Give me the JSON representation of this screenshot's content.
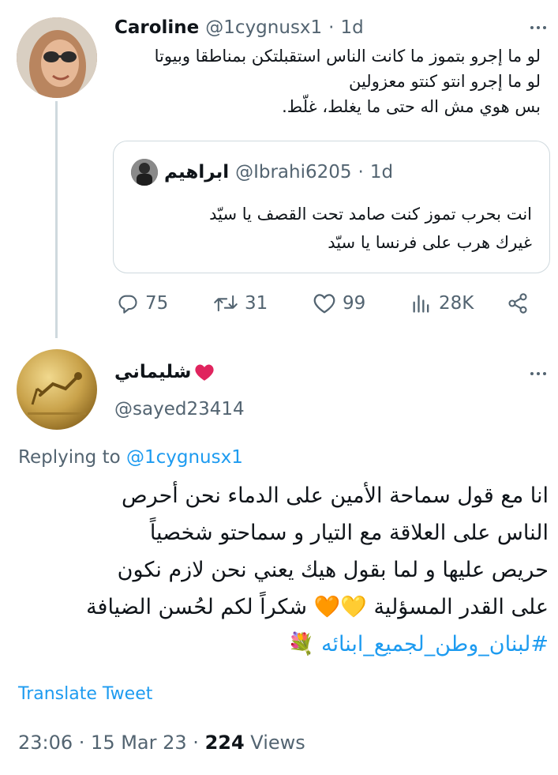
{
  "tweet1": {
    "display_name": "Caroline",
    "handle": "@1cygnusx1",
    "separator": "·",
    "time": "1d",
    "lines": [
      "لو ما إجرو بتموز ما كانت الناس استقبلتكن بمناطقا وبيوتا",
      "لو ما إجرو انتو كنتو معزولين",
      "بس هوي مش اله حتى ما يغلط، غلّط."
    ],
    "quote": {
      "display_name": "ابراهيم",
      "handle": "@Ibrahi6205",
      "separator": "·",
      "time": "1d",
      "lines": [
        "انت بحرب تموز كنت صامد تحت القصف يا سيّد",
        "غيرك هرب على فرنسا يا سيّد"
      ]
    },
    "actions": {
      "replies": "75",
      "retweets": "31",
      "likes": "99",
      "views": "28K"
    }
  },
  "tweet2": {
    "display_name": "شليماني",
    "handle": "@sayed23414",
    "replying_prefix": "Replying to",
    "replying_handle": "@1cygnusx1",
    "lines": [
      "انا مع قول سماحة الأمين على الدماء نحن أحرص",
      "الناس على العلاقة مع التيار و سماحتو شخصياً",
      "حريص عليها و لما بقول هيك يعني نحن لازم نكون",
      "على القدر المسؤلية 💛🧡 شكراً لكم لحُسن الضيافة"
    ],
    "hashtag": "#لبنان_وطن_لجميع_ابنائه",
    "hashtag_emoji": "💐",
    "translate_label": "Translate Tweet",
    "timestamp": "23:06 · 15 Mar 23 · ",
    "views_count": "224",
    "views_label": " Views"
  },
  "colors": {
    "accent": "#1d9bf0",
    "muted": "#536471",
    "heart": "#f91880",
    "border": "#cfd9de"
  }
}
